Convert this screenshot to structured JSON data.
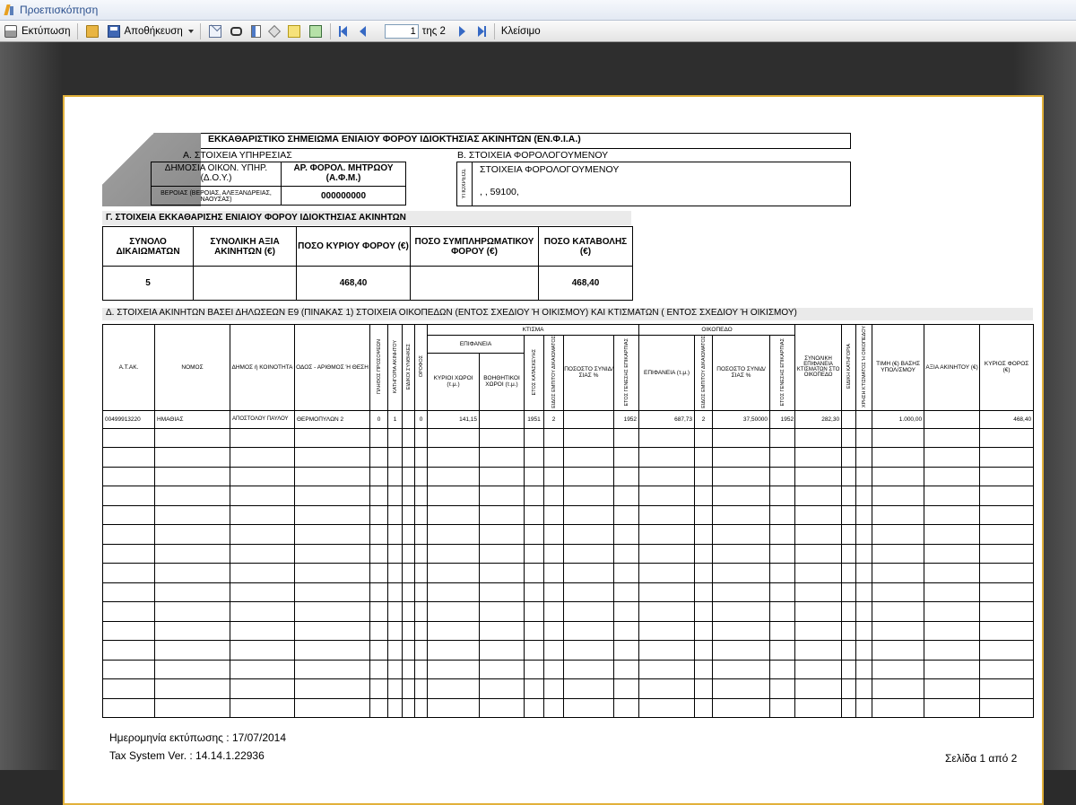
{
  "window": {
    "title": "Προεπισκόπηση"
  },
  "toolbar": {
    "print_label": "Εκτύπωση",
    "save_label": "Αποθήκευση",
    "page_value": "1",
    "page_of": "της 2",
    "close_label": "Κλείσιμο"
  },
  "doc": {
    "header_title": "ΕΚΚΑΘΑΡΙΣΤΙΚΟ ΣΗΜΕΙΩΜΑ ΕΝΙΑΙΟΥ ΦΟΡΟΥ ΙΔΙΟΚΤΗΣΙΑΣ ΑΚΙΝΗΤΩΝ (ΕΝ.Φ.Ι.Α.)",
    "badge": "ΕΝ.Φ.Ι.Α.",
    "sectionA": "Α. ΣΤΟΙΧΕΙΑ ΥΠΗΡΕΣΙΑΣ",
    "sectionB": "Β. ΣΤΟΙΧΕΙΑ ΦΟΡΟΛΟΓΟΥΜΕΝΟΥ",
    "doy_label": "ΔΗΜΟΣΙΑ ΟΙΚΟΝ. ΥΠΗΡ. (Δ.Ο.Υ.)",
    "afm_label": "ΑΡ. ΦΟΡΟΛ. ΜΗΤΡΩΟΥ (Α.Φ.Μ.)",
    "doy_value": "ΒΕΡΟΙΑΣ (ΒΕΡΟΙΑΣ, ΑΛΕΞΑΝΔΡΕΙΑΣ, ΝΑΟΥΣΑΣ)",
    "afm_value": "000000000",
    "ypoxreos_label": "ΥΠΟΧΡΕΟΣ",
    "taxpayer_name": "ΣΤΟΙΧΕΙΑ ΦΟΡΟΛΟΓΟΥΜΕΝΟΥ",
    "taxpayer_addr": ", , 59100,",
    "sectionC": "Γ. ΣΤΟΙΧΕΙΑ ΕΚΚΑΘΑΡΙΣΗΣ ΕΝΙΑΙΟΥ ΦΟΡΟΥ ΙΔΙΟΚΤΗΣΙΑΣ ΑΚΙΝΗΤΩΝ",
    "summary_headers": [
      "ΣΥΝΟΛΟ ΔΙΚΑΙΩΜΑΤΩΝ",
      "ΣΥΝΟΛΙΚΗ ΑΞΙΑ ΑΚΙΝΗΤΩΝ (€)",
      "ΠΟΣΟ ΚΥΡΙΟΥ ΦΟΡΟΥ (€)",
      "ΠΟΣΟ ΣΥΜΠΛΗΡΩΜΑΤΙΚΟΥ ΦΟΡΟΥ (€)",
      "ΠΟΣΟ ΚΑΤΑΒΟΛΗΣ (€)"
    ],
    "summary_values": [
      "5",
      "",
      "468,40",
      "",
      "468,40"
    ],
    "sectionD": "Δ. ΣΤΟΙΧΕΙΑ ΑΚΙΝΗΤΩΝ ΒΑΣΕΙ ΔΗΛΩΣΕΩΝ Ε9 (ΠΙΝΑΚΑΣ 1) ΣΤΟΙΧΕΙΑ ΟΙΚΟΠΕΔΩΝ (ΕΝΤΟΣ ΣΧΕΔΙΟΥ Ή ΟΙΚΙΣΜΟΥ) ΚΑΙ ΚΤΙΣΜΑΤΩΝ ( ΕΝΤΟΣ ΣΧΕΔΙΟΥ Ή ΟΙΚΙΣΜΟΥ)",
    "detail": {
      "group_ktisma": "ΚΤΙΣΜΑ",
      "group_oikopedo": "ΟΙΚΟΠΕΔΟ",
      "group_epifaneia": "ΕΠΙΦΑΝΕΙΑ",
      "h_atak": "Α.Τ.ΑΚ.",
      "h_nomos": "ΝΟΜΟΣ",
      "h_dimos": "ΔΗΜΟΣ ή ΚΟΙΝΟΤΗΤΑ",
      "h_odos": "ΟΔΟΣ - ΑΡΙΘΜΟΣ Ή ΘΕΣΗ",
      "h_v1": "ΠΛΗΘΟΣ ΠΡΟΣΟΨΕΩΝ",
      "h_v2": "ΚΑΤΗΓΟΡΙΑ ΑΚΙΝΗΤΟΥ",
      "h_v3": "ΕΙΔΙΚΟΙ ΣΥΝΘΗΚΕΣ",
      "h_v4": "ΟΡΟΦΟΣ",
      "h_kyrioi": "ΚΥΡΙΟΙ ΧΩΡΟΙ (τ.μ.)",
      "h_voith": "ΒΟΗΘΗΤΙΚΟΙ ΧΩΡΟΙ (τ.μ.)",
      "h_v5": "ΕΤΟΣ ΚΑΤΑΣΚΕΥΗΣ",
      "h_v6": "ΕΙΔΟΣ ΕΜΠΙΤΟΥ ΔΙΚΑΙΩΜΑΤΟΣ",
      "h_pososto": "ΠΟΣΟΣΤΟ ΣΥΝΙΔ/ΣΙΑΣ %",
      "h_v7": "ΕΤΟΣ ΓΕΝΕΣΗΣ ΕΠΙΚΑΡΠΙΑΣ",
      "h_epif_oik": "ΕΠΙΦΑΝΕΙΑ (τ.μ.)",
      "h_v8": "ΕΙΔΟΣ ΕΜΠΙΤΟΥ ΔΙΚΑΙΩΜΑΤΟΣ",
      "h_pososto2": "ΠΟΣΟΣΤΟ ΣΥΝΙΔ/ΣΙΑΣ %",
      "h_v9": "ΕΤΟΣ ΓΕΝΕΣΗΣ ΕΠΙΚΑΡΠΙΑΣ",
      "h_synol": "ΣΥΝΟΛΙΚΗ ΕΠΙΦΑΝΕΙΑ ΚΤΙΣΜΑΤΩΝ ΣΤΟ ΟΙΚΟΠΕΔΟ",
      "h_v10": "ΕΙΔΙΚΗ ΚΑΤΗΓΟΡΙΑ",
      "h_v11": "ΧΡΗΣΗ ΚΤΙΣΜΑΤΟΣ Ή ΟΙΚΟΠΕΔΟΥ",
      "h_timi": "ΤΙΜΗ (€) ΒΑΣΗΣ ΥΠΟΛ/ΣΜΟΥ",
      "h_axia": "ΑΞΙΑ ΑΚΙΝΗΤΟΥ (€)",
      "h_kyrios": "ΚΥΡΙΟΣ ΦΟΡΟΣ (€)",
      "row1": [
        "00499913220",
        "ΗΜΑΘΙΑΣ",
        "ΑΠΟΣΤΟΛΟΥ ΠΑΥΛΟΥ",
        "ΘΕΡΜΟΠΥΛΩΝ 2",
        "0",
        "1",
        "",
        "0",
        "141,15",
        "",
        "1951",
        "2",
        "",
        "1952",
        "687,73",
        "2",
        "37,50000",
        "1952",
        "282,30",
        "",
        "",
        "1.000,00",
        "",
        "468,40"
      ]
    },
    "print_date": "Ημερομηνία εκτύπωσης : 17/07/2014",
    "version": "Tax System Ver. : 14.14.1.22936",
    "page_footer": "Σελίδα 1 από 2"
  }
}
